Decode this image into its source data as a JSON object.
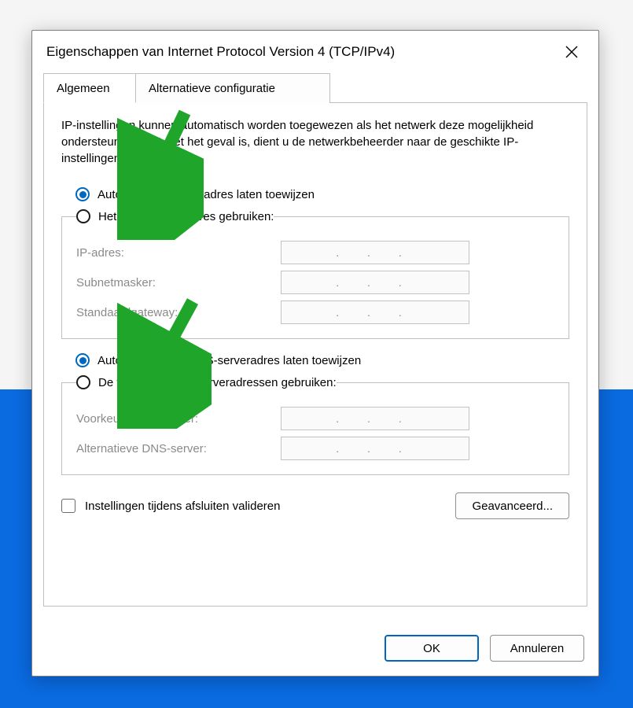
{
  "window": {
    "title": "Eigenschappen van Internet Protocol Version 4 (TCP/IPv4)"
  },
  "tabs": {
    "general": "Algemeen",
    "alternate": "Alternatieve configuratie",
    "active": "general"
  },
  "description": "IP-instellingen kunnen automatisch worden toegewezen als het netwerk deze mogelijkheid ondersteunt. Als dit niet het geval is, dient u de netwerkbeheerder naar de geschikte IP-instellingen te vragen.",
  "ip_section": {
    "auto_label": "Automatisch een IP-adres laten toewijzen",
    "manual_label": "Het volgende IP-adres gebruiken:",
    "selected": "auto",
    "fields": {
      "ip_address_label": "IP-adres:",
      "subnet_label": "Subnetmasker:",
      "gateway_label": "Standaardgateway:",
      "ip_address": "",
      "subnet": "",
      "gateway": ""
    }
  },
  "dns_section": {
    "auto_label": "Automatisch een DNS-serveradres laten toewijzen",
    "manual_label": "De volgende DNS-serveradressen gebruiken:",
    "selected": "auto",
    "fields": {
      "preferred_label": "Voorkeurs-DNS-server:",
      "alternate_label": "Alternatieve DNS-server:",
      "preferred": "",
      "alternate": ""
    }
  },
  "validate_on_exit": {
    "label": "Instellingen tijdens afsluiten valideren",
    "checked": false
  },
  "buttons": {
    "advanced": "Geavanceerd...",
    "ok": "OK",
    "cancel": "Annuleren"
  },
  "ip_placeholder": ".   .   ."
}
